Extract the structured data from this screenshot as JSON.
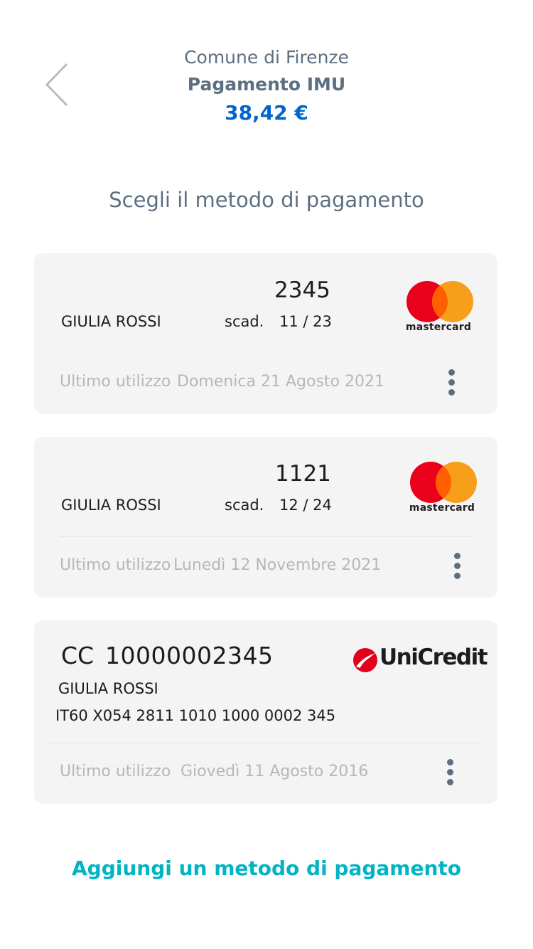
{
  "header": {
    "entity": "Comune di Firenze",
    "title": "Pagamento IMU",
    "amount": "38,42 €"
  },
  "section_title": "Scegli il metodo di pagamento",
  "cards": [
    {
      "type": "card",
      "number": "2345",
      "holder": "GIULIA ROSSI",
      "exp_label": "scad.",
      "exp": "11 / 23",
      "brand": "mastercard",
      "last_use_label": "Ultimo utilizzo",
      "last_use_date": "Domenica 21 Agosto 2021"
    },
    {
      "type": "card",
      "number": "1121",
      "holder": "GIULIA ROSSI",
      "exp_label": "scad.",
      "exp": "12 / 24",
      "brand": "mastercard",
      "last_use_label": "Ultimo utilizzo",
      "last_use_date": "Lunedì 12 Novembre 2021"
    },
    {
      "type": "bank_account",
      "prefix": "CC",
      "number": "10000002345",
      "holder": "GIULIA ROSSI",
      "iban": "IT60 X054 2811 1010 1000 0002 345",
      "brand": "UniCredit",
      "last_use_label": "Ultimo utilizzo",
      "last_use_date": "Giovedì 11 Agosto 2016"
    }
  ],
  "add_method_label": "Aggiungi un metodo di pagamento",
  "icons": {
    "back": "chevron-left-icon",
    "more": "more-vertical-icon"
  },
  "colors": {
    "primary_text": "#5c6f82",
    "amount": "#0066cc",
    "accent_link": "#00b4c5",
    "card_bg": "#f4f4f4",
    "muted": "#b5b7ba",
    "mastercard_red": "#eb001b",
    "mastercard_orange": "#f79e1b",
    "unicredit_red": "#e2001a"
  }
}
